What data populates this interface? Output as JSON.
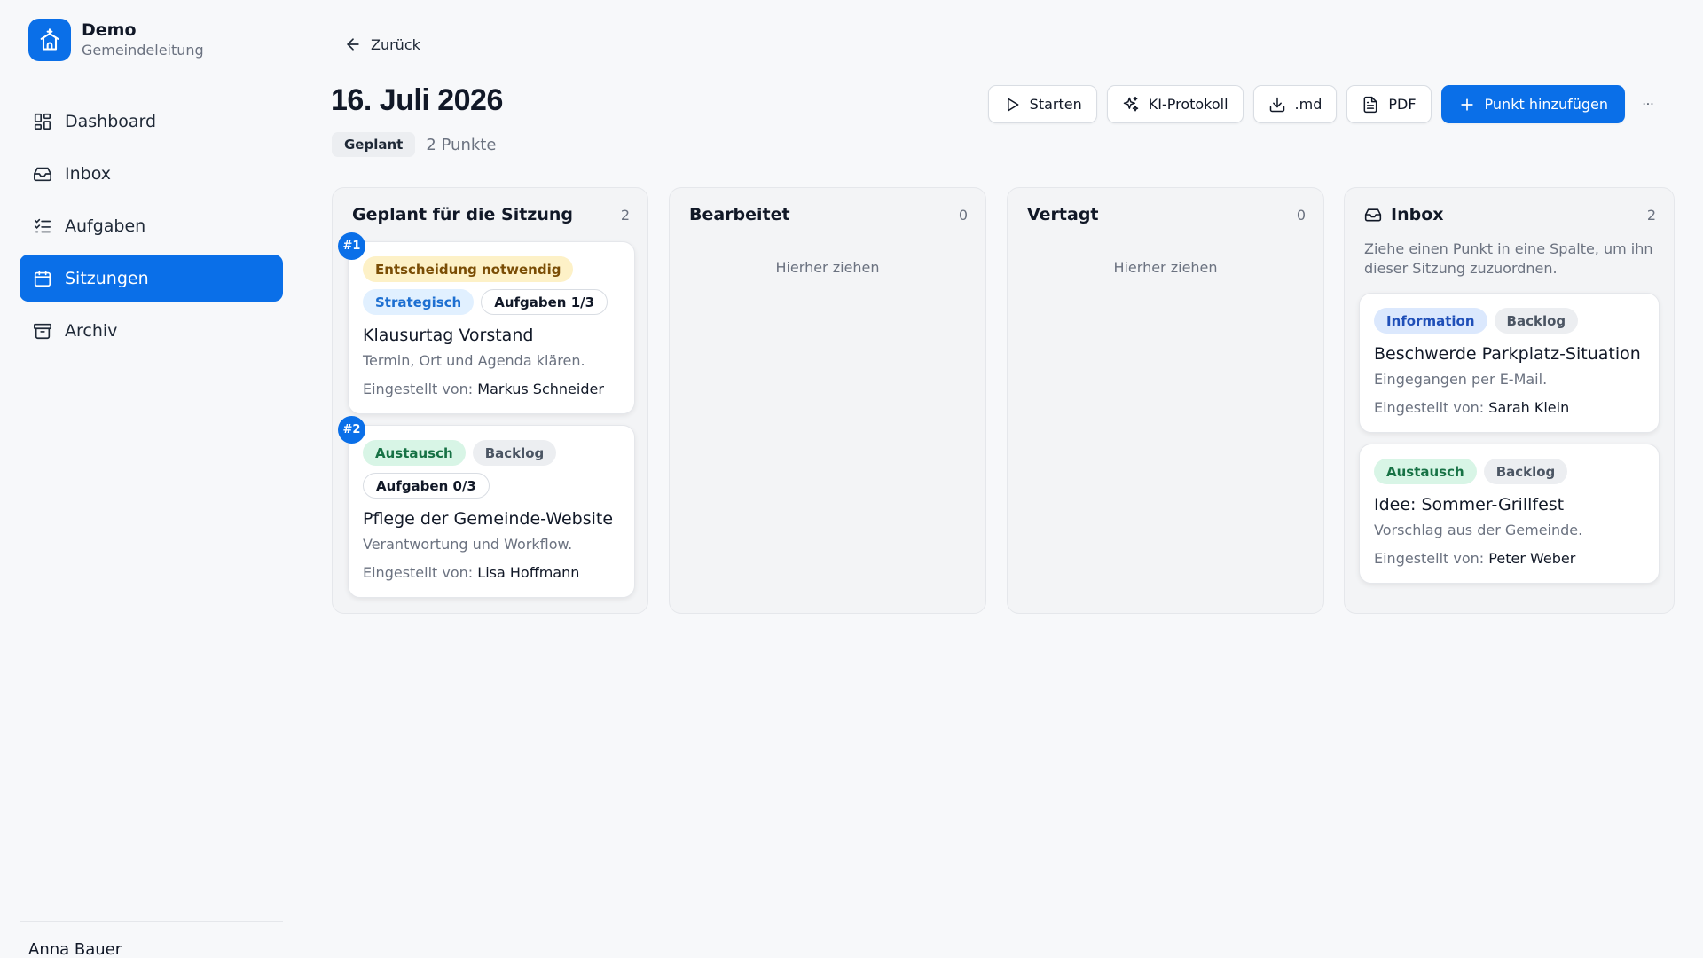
{
  "brand": {
    "name": "Demo",
    "subtitle": "Gemeindeleitung"
  },
  "nav": {
    "items": [
      {
        "label": "Dashboard",
        "icon": "dashboard-icon"
      },
      {
        "label": "Inbox",
        "icon": "inbox-icon"
      },
      {
        "label": "Aufgaben",
        "icon": "tasks-icon"
      },
      {
        "label": "Sitzungen",
        "icon": "calendar-icon",
        "active": true
      },
      {
        "label": "Archiv",
        "icon": "archive-icon"
      }
    ]
  },
  "user": {
    "name": "Anna Bauer"
  },
  "header": {
    "back_label": "Zurück",
    "title": "16. Juli 2026",
    "status": "Geplant",
    "points": "2 Punkte"
  },
  "toolbar": {
    "start": "Starten",
    "ai_protocol": "KI-Protokoll",
    "markdown": ".md",
    "pdf": "PDF",
    "add_point": "Punkt hinzufügen",
    "more": "···"
  },
  "columns": {
    "planned": {
      "title": "Geplant für die Sitzung",
      "count": "2",
      "cards": [
        {
          "number": "#1",
          "tags": [
            "Entscheidung notwendig",
            "Strategisch",
            "Aufgaben 1/3"
          ],
          "title": "Klausurtag Vorstand",
          "description": "Termin, Ort und Agenda klären.",
          "meta_label": "Eingestellt von:",
          "author": "Markus Schneider"
        },
        {
          "number": "#2",
          "tags": [
            "Austausch",
            "Backlog",
            "Aufgaben 0/3"
          ],
          "title": "Pflege der Gemeinde-Website",
          "description": "Verantwortung und Workflow.",
          "meta_label": "Eingestellt von:",
          "author": "Lisa Hoffmann"
        }
      ]
    },
    "edited": {
      "title": "Bearbeitet",
      "count": "0",
      "hint": "Hierher ziehen"
    },
    "postponed": {
      "title": "Vertagt",
      "count": "0",
      "hint": "Hierher ziehen"
    },
    "inbox": {
      "title": "Inbox",
      "count": "2",
      "hint": "Ziehe einen Punkt in eine Spalte, um ihn dieser Sitzung zuzuordnen.",
      "cards": [
        {
          "tags": [
            "Information",
            "Backlog"
          ],
          "title": "Beschwerde Parkplatz-Situation",
          "description": "Eingegangen per E-Mail.",
          "meta_label": "Eingestellt von:",
          "author": "Sarah Klein"
        },
        {
          "tags": [
            "Austausch",
            "Backlog"
          ],
          "title": "Idee: Sommer-Grillfest",
          "description": "Vorschlag aus der Gemeinde.",
          "meta_label": "Eingestellt von:",
          "author": "Peter Weber"
        }
      ]
    }
  },
  "colors": {
    "primary": "#0a6fe8",
    "background": "#f7f8fa"
  }
}
